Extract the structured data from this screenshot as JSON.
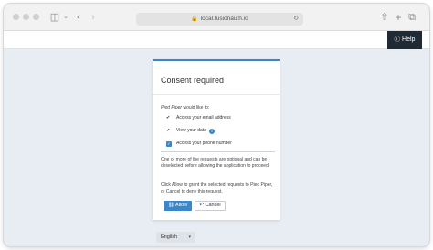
{
  "browser": {
    "url": "local.fusionauth.io",
    "lock_icon": "lock-icon",
    "reload_icon": "reload-icon"
  },
  "header": {
    "help_label": "Help"
  },
  "consent": {
    "title": "Consent required",
    "app_name": "Pied Piper",
    "intro_suffix": " would like to:",
    "scopes": [
      {
        "label": "Access your email address",
        "type": "required"
      },
      {
        "label": "View your data",
        "type": "required",
        "info": true
      },
      {
        "label": "Access your phone number",
        "type": "optional",
        "checked": true
      }
    ],
    "optional_note": "One or more of the requests are optional and can be deselected before allowing the application to proceed.",
    "instructions": "Click Allow to grant the selected requests to Pied Piper, or Cancel to deny this request.",
    "allow_label": "Allow",
    "cancel_label": "Cancel"
  },
  "footer": {
    "language_selected": "English"
  },
  "colors": {
    "accent": "#3a86c8",
    "help_bg": "#1f2a35",
    "page_bg": "#e8edf3"
  }
}
